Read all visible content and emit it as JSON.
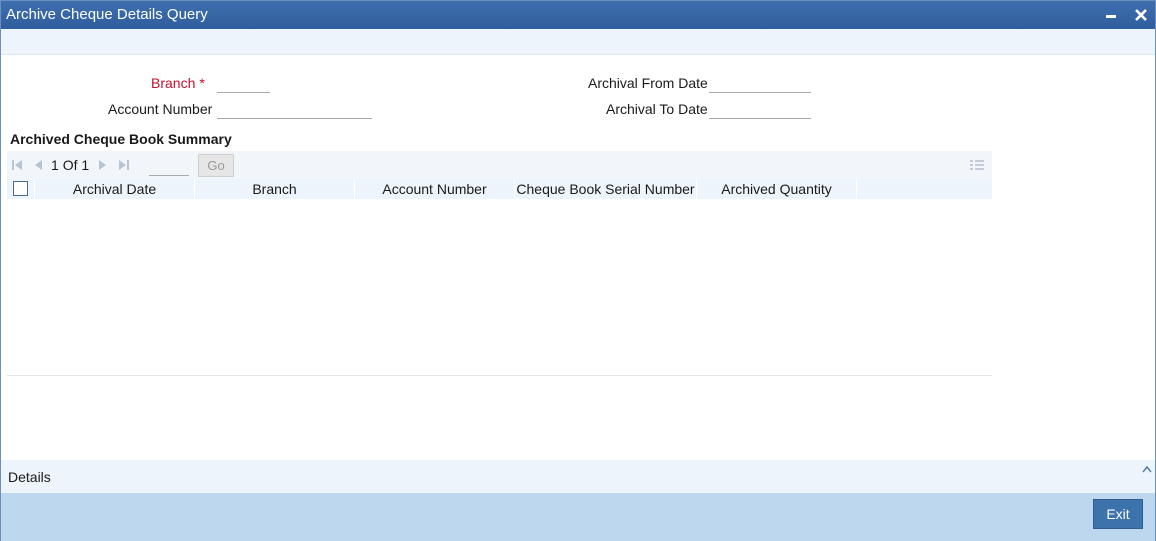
{
  "window": {
    "title": "Archive Cheque Details Query"
  },
  "form": {
    "branch_label": "Branch",
    "branch_required_mark": "*",
    "branch_value": "",
    "account_number_label": "Account Number",
    "account_number_value": "",
    "archival_from_date_label": "Archival From Date",
    "archival_from_date_value": "",
    "archival_to_date_label": "Archival To Date",
    "archival_to_date_value": ""
  },
  "summary": {
    "title": "Archived Cheque Book Summary",
    "pager": {
      "current_page": "1",
      "of_label": "Of",
      "total_pages": "1",
      "go_label": "Go"
    },
    "columns": [
      "Archival Date",
      "Branch",
      "Account Number",
      "Cheque Book Serial Number",
      "Archived Quantity"
    ],
    "rows": []
  },
  "details_bar": {
    "label": "Details"
  },
  "footer": {
    "exit_label": "Exit"
  },
  "colors": {
    "titlebar": "#2f5d9d",
    "required_label": "#c8102e",
    "footer_bg": "#bdd8ee",
    "exit_button": "#3d73ac",
    "grid_header": "#eef4fb"
  },
  "icons": {
    "minimize": "minimize-icon",
    "close": "close-icon",
    "first_page": "first-page-icon",
    "previous_page": "previous-page-icon",
    "next_page": "next-page-icon",
    "last_page": "last-page-icon",
    "column_list": "list-icon",
    "collapse": "chevron-up-icon"
  }
}
